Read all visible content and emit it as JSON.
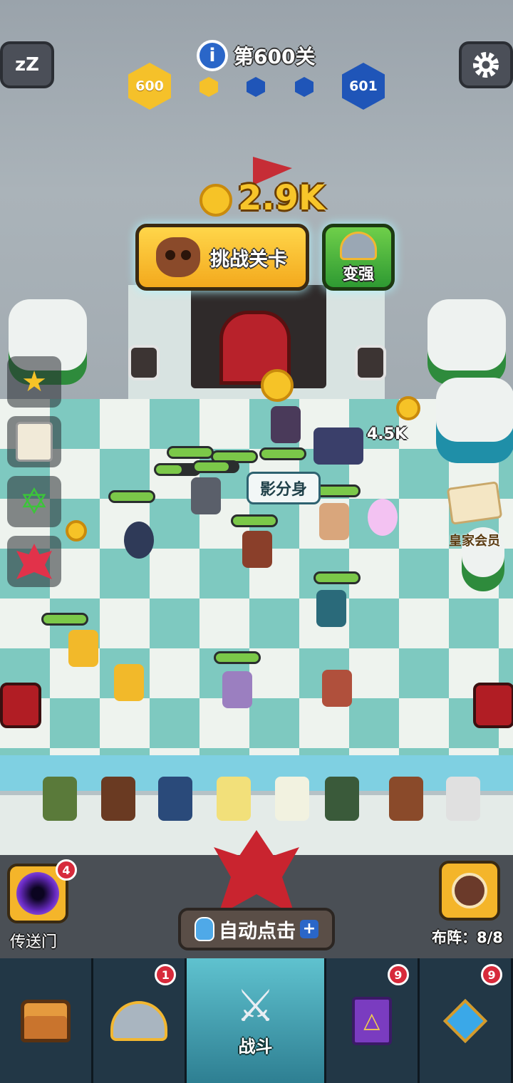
{
  "top_bar": {
    "sleep_icon_text": "zZ",
    "level_title": "第600关",
    "current_level": "600",
    "next_level": "601",
    "progress_nodes": [
      {
        "state": "completed",
        "color": "#f5c12a"
      },
      {
        "state": "pending",
        "color": "#1f55b8"
      },
      {
        "state": "pending",
        "color": "#1f55b8"
      }
    ]
  },
  "reward": {
    "amount": "2.9K"
  },
  "challenge_button": {
    "label": "挑战关卡"
  },
  "power_button": {
    "label": "变强"
  },
  "battlefield": {
    "skill_tag": "影分身",
    "coin_drop": "4.5K",
    "royal_member_label": "皇家会员"
  },
  "side_menu": [
    {
      "icon": "leaderboard-icon"
    },
    {
      "icon": "scroll-icon"
    },
    {
      "icon": "hexagram-icon"
    },
    {
      "icon": "red-leaf-icon"
    }
  ],
  "portal": {
    "label": "传送门",
    "badge": "4"
  },
  "auto_click": {
    "label": "自动点击"
  },
  "formation": {
    "label": "布阵：8/8"
  },
  "nav": {
    "tabs": [
      {
        "icon": "treasure-chest-icon",
        "label": "",
        "badge": ""
      },
      {
        "icon": "viking-helmet-icon",
        "label": "",
        "badge": "1"
      },
      {
        "icon": "crossed-swords-icon",
        "label": "战斗",
        "badge": ""
      },
      {
        "icon": "spellbook-icon",
        "label": "",
        "badge": "9"
      },
      {
        "icon": "amulet-icon",
        "label": "",
        "badge": "9"
      }
    ]
  },
  "colors": {
    "gold": "#f5c12a",
    "blue": "#1f55b8",
    "badge_red": "#d72a3b",
    "board_teal": "#7ec9c0",
    "nav_active": "#5fc2cf"
  }
}
